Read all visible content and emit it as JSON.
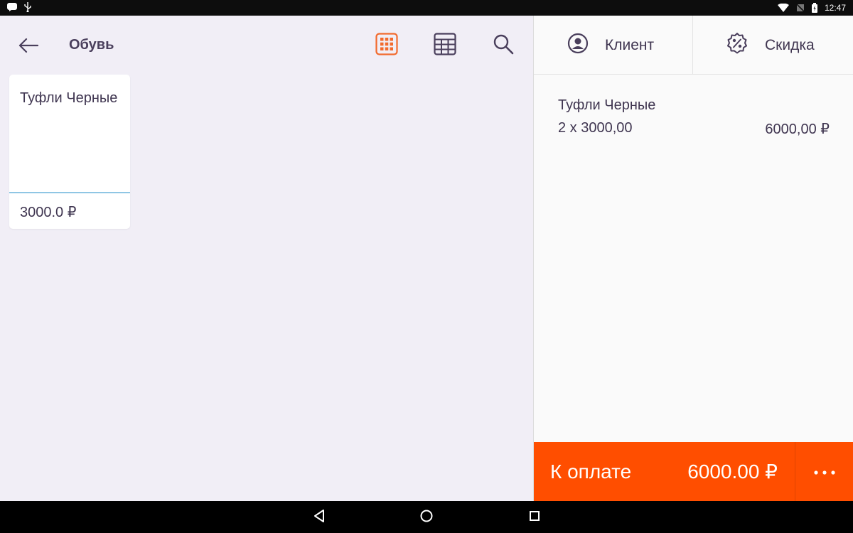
{
  "status_bar": {
    "time": "12:47",
    "left_icons": [
      "message-icon",
      "usb-icon"
    ],
    "right_icons": [
      "wifi-icon",
      "no-sim-icon",
      "battery-icon"
    ]
  },
  "toolbar": {
    "title": "Обувь",
    "icons": [
      "back-arrow-icon",
      "grid-view-icon",
      "table-view-icon",
      "search-icon"
    ],
    "active_view": "grid"
  },
  "products": [
    {
      "name": "Туфли Черные",
      "price": "3000.0 ₽"
    }
  ],
  "right_header": {
    "client_label": "Клиент",
    "discount_label": "Скидка"
  },
  "order": {
    "items": [
      {
        "name": "Туфли Черные",
        "qty_price": "2 x 3000,00",
        "total": "6000,00 ₽"
      }
    ]
  },
  "payment": {
    "label": "К оплате",
    "amount": "6000.00 ₽",
    "more_label": "⋯"
  },
  "colors": {
    "accent": "#ff4e00",
    "active_icon": "#f26a2d",
    "text": "#3f3550",
    "left_bg": "#f1eef6",
    "card_divider": "#8fc6e4"
  },
  "nav_bar": {
    "icons": [
      "nav-back-icon",
      "nav-home-icon",
      "nav-recents-icon"
    ]
  }
}
